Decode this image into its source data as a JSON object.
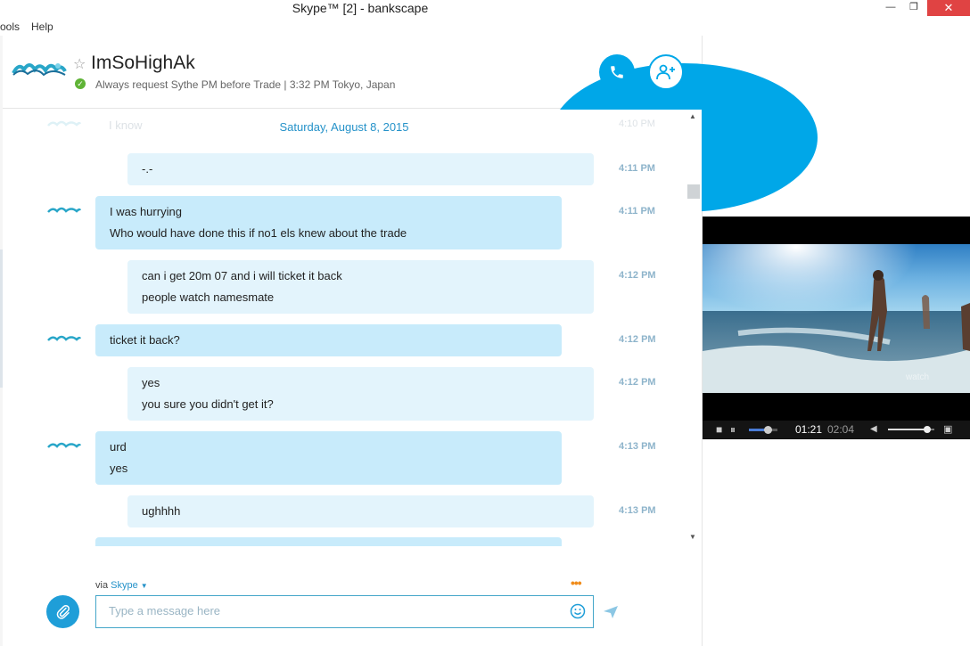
{
  "window": {
    "title": "Skype™ [2] - bankscape",
    "minimize_glyph": "—",
    "maximize_glyph": "❐",
    "close_glyph": "✕"
  },
  "menu": {
    "items": [
      "ools",
      "Help"
    ]
  },
  "header": {
    "contact_name": "ImSoHighAk",
    "mood": "Always request Sythe PM before Trade  |  3:32 PM Tokyo, Japan",
    "status_color": "#5fb336",
    "accent_color": "#00a7e8",
    "icons": [
      "star-icon",
      "video-call-icon",
      "phone-icon",
      "add-contact-icon"
    ]
  },
  "chat": {
    "faded_top": {
      "text": "I know",
      "time": "4:10 PM"
    },
    "date_separator": "Saturday, August 8, 2015",
    "messages": [
      {
        "dir": "out",
        "lines": [
          "-.-"
        ],
        "time": "4:11 PM"
      },
      {
        "dir": "in",
        "lines": [
          "I was hurrying",
          "Who would have done this if no1 els knew about the trade"
        ],
        "time": "4:11 PM"
      },
      {
        "dir": "out",
        "lines": [
          "can i get 20m 07 and i will ticket it back",
          "people watch namesmate"
        ],
        "time": "4:12 PM"
      },
      {
        "dir": "in",
        "lines": [
          "ticket it back?"
        ],
        "time": "4:12 PM"
      },
      {
        "dir": "out",
        "lines": [
          "yes",
          "you sure you didn't get it?"
        ],
        "time": "4:12 PM"
      },
      {
        "dir": "in",
        "lines": [
          "urd",
          "yes"
        ],
        "time": "4:13 PM"
      },
      {
        "dir": "out",
        "lines": [
          "ughhhh"
        ],
        "time": "4:13 PM"
      }
    ]
  },
  "compose": {
    "via_label": "via",
    "via_service": "Skype",
    "placeholder": "Type a message here",
    "typing_indicator": "•••"
  },
  "video_player": {
    "current_time": "01:21",
    "duration": "02:04",
    "progress": 0.65,
    "volume": 0.85
  }
}
